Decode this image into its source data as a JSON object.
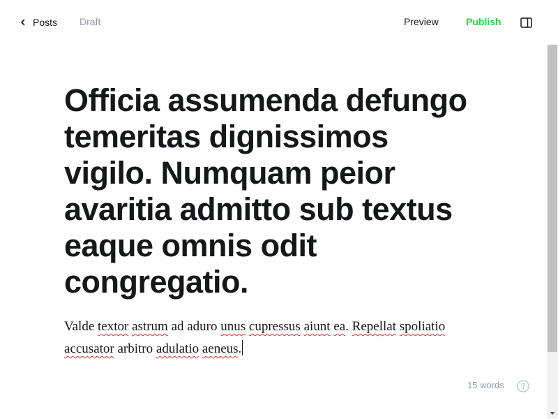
{
  "header": {
    "back_label": "Posts",
    "status": "Draft",
    "preview_label": "Preview",
    "publish_label": "Publish",
    "back_icon": "chevron-left-icon",
    "sidebar_icon": "sidebar-panel-icon"
  },
  "editor": {
    "title": "Officia assumenda defungo temeritas dignissimos vigilo. Numquam peior avaritia admitto sub textus eaque omnis odit congregatio.",
    "body": {
      "segments": [
        {
          "text": "Valde ",
          "misspelled": false
        },
        {
          "text": "textor",
          "misspelled": true
        },
        {
          "text": " ",
          "misspelled": false
        },
        {
          "text": "astrum",
          "misspelled": true
        },
        {
          "text": " ad aduro ",
          "misspelled": false
        },
        {
          "text": "unus",
          "misspelled": true
        },
        {
          "text": " ",
          "misspelled": false
        },
        {
          "text": "cupressus",
          "misspelled": true
        },
        {
          "text": " ",
          "misspelled": false
        },
        {
          "text": "aiunt",
          "misspelled": true
        },
        {
          "text": " ",
          "misspelled": false
        },
        {
          "text": "ea",
          "misspelled": true
        },
        {
          "text": ". ",
          "misspelled": false
        },
        {
          "text": "Repellat",
          "misspelled": true
        },
        {
          "text": " ",
          "misspelled": false
        },
        {
          "text": "spoliatio",
          "misspelled": true
        },
        {
          "text": " ",
          "misspelled": false
        },
        {
          "text": "accusator",
          "misspelled": true
        },
        {
          "text": " arbitro ",
          "misspelled": false
        },
        {
          "text": "adulatio",
          "misspelled": true
        },
        {
          "text": " ",
          "misspelled": false
        },
        {
          "text": "aeneus",
          "misspelled": true
        },
        {
          "text": ".",
          "misspelled": false
        }
      ]
    },
    "word_count": "15 words",
    "help_icon": "help-circle-icon"
  },
  "colors": {
    "text": "#15171a",
    "muted": "#8e9cac",
    "publish": "#30cf43",
    "spellcheck": "#e0302f",
    "scroll_thumb": "#c1c1c1",
    "scroll_track": "#f1f1f1"
  }
}
